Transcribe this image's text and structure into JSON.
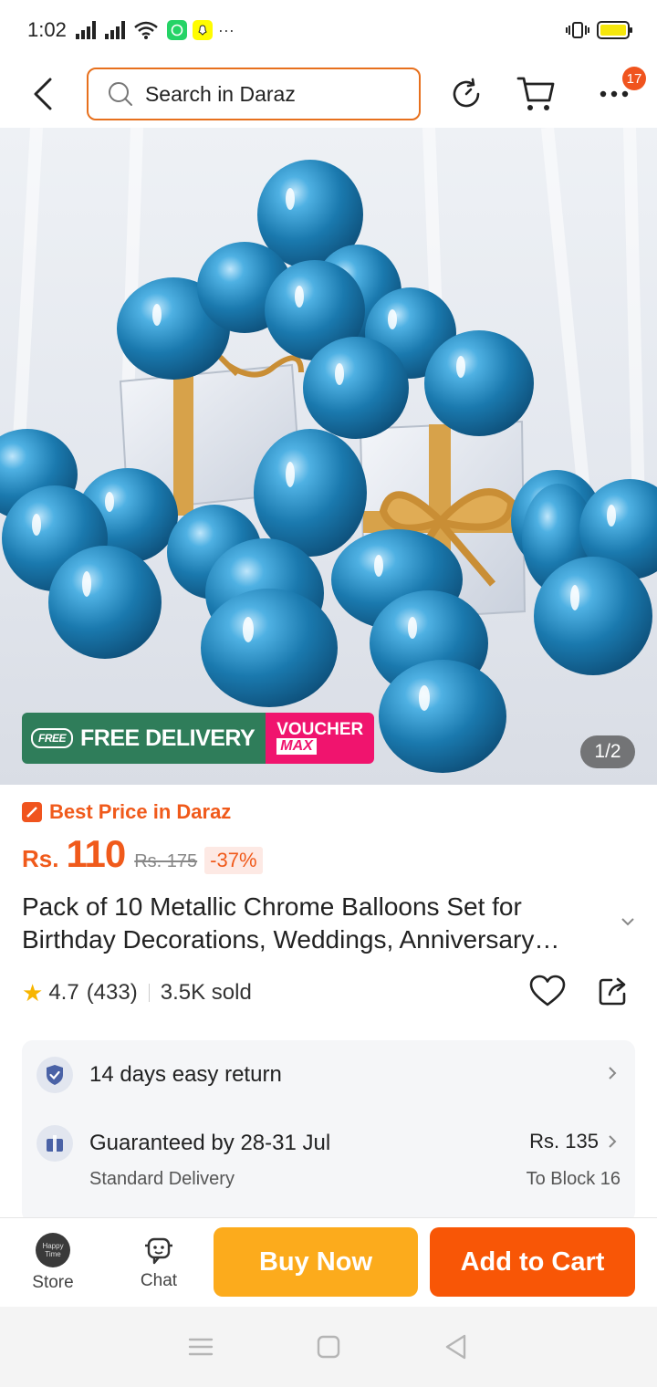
{
  "status_bar": {
    "time": "1:02",
    "overflow": "···",
    "icons": [
      "signal-icon",
      "signal-icon",
      "wifi-icon",
      "whatsapp-icon",
      "snapchat-icon",
      "vibrate-icon",
      "battery-icon"
    ]
  },
  "header": {
    "search_placeholder": "Search in Daraz",
    "cart_count": "17",
    "icons": [
      "back-arrow-icon",
      "search-icon",
      "history-icon",
      "cart-icon",
      "more-icon"
    ]
  },
  "hero": {
    "badge_free_tag": "FREE",
    "badge_free_delivery": "FREE DELIVERY",
    "badge_voucher": "VOUCHER",
    "badge_max": "MAX",
    "page_indicator": "1/2"
  },
  "product": {
    "best_price_label": "Best Price in Daraz",
    "currency": "Rs.",
    "price": "110",
    "original_price": "Rs. 175",
    "discount": "-37%",
    "title": "Pack of 10 Metallic Chrome Balloons Set for Birthday Decorations, Weddings, Anniversary…",
    "rating": "4.7",
    "rating_count": "(433)",
    "sold": "3.5K sold"
  },
  "info": {
    "return_label": "14 days easy return",
    "delivery_label": "Guaranteed by 28-31 Jul",
    "delivery_type": "Standard Delivery",
    "delivery_price": "Rs. 135",
    "delivery_location": "To Block 16"
  },
  "bottom_bar": {
    "store_label": "Store",
    "store_logo_text": "Happy Time",
    "chat_label": "Chat",
    "buy_now_label": "Buy Now",
    "add_to_cart_label": "Add to Cart"
  },
  "colors": {
    "accent": "#f85606",
    "buy_now": "#fcab1c",
    "price": "#f05a1b",
    "balloon": "#1d7fb3",
    "free_delivery": "#2f7d5a",
    "voucher": "#f0146e"
  }
}
